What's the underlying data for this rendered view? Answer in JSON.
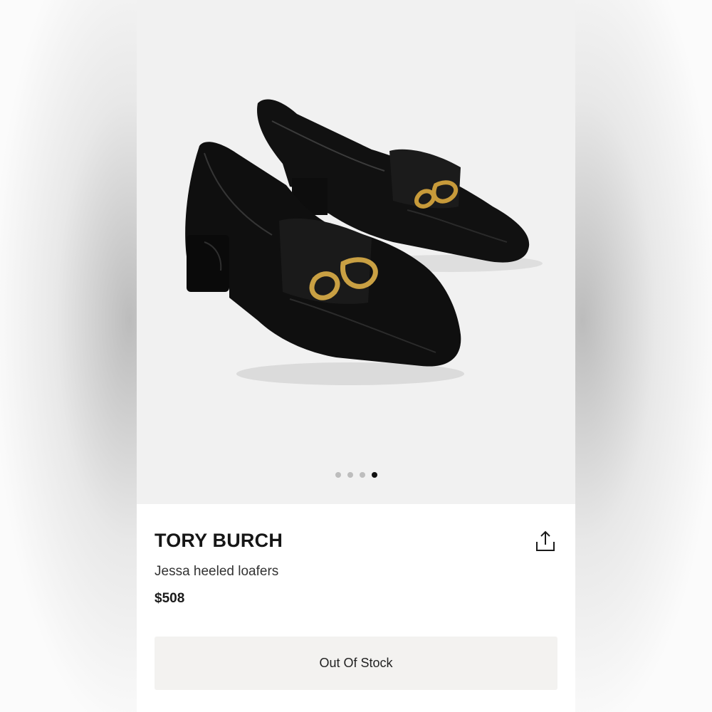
{
  "gallery": {
    "image_alt": "Black patent heeled loafers with gold chain hardware",
    "slides": 4,
    "active_slide": 4
  },
  "product": {
    "brand": "TORY BURCH",
    "name": "Jessa heeled loafers",
    "price": "$508"
  },
  "actions": {
    "share_icon": "share-icon",
    "stock_status": "Out Of Stock"
  }
}
